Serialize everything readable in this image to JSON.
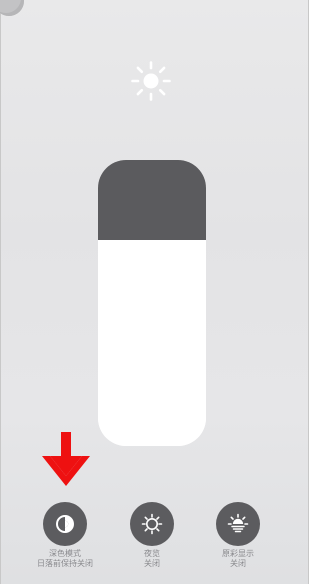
{
  "brightness": {
    "level": 0.72
  },
  "controls": [
    {
      "icon": "dark-mode-icon",
      "label": "深色模式",
      "sub": "日落前保持关闭"
    },
    {
      "icon": "night-shift-icon",
      "label": "夜览",
      "sub": "关闭"
    },
    {
      "icon": "true-tone-icon",
      "label": "原彩显示",
      "sub": "关闭"
    }
  ],
  "colors": {
    "annotation_arrow": "#ee1111",
    "button_bg": "#5c5c5f",
    "slider_empty": "#5b5b5e",
    "slider_fill": "#ffffff"
  }
}
